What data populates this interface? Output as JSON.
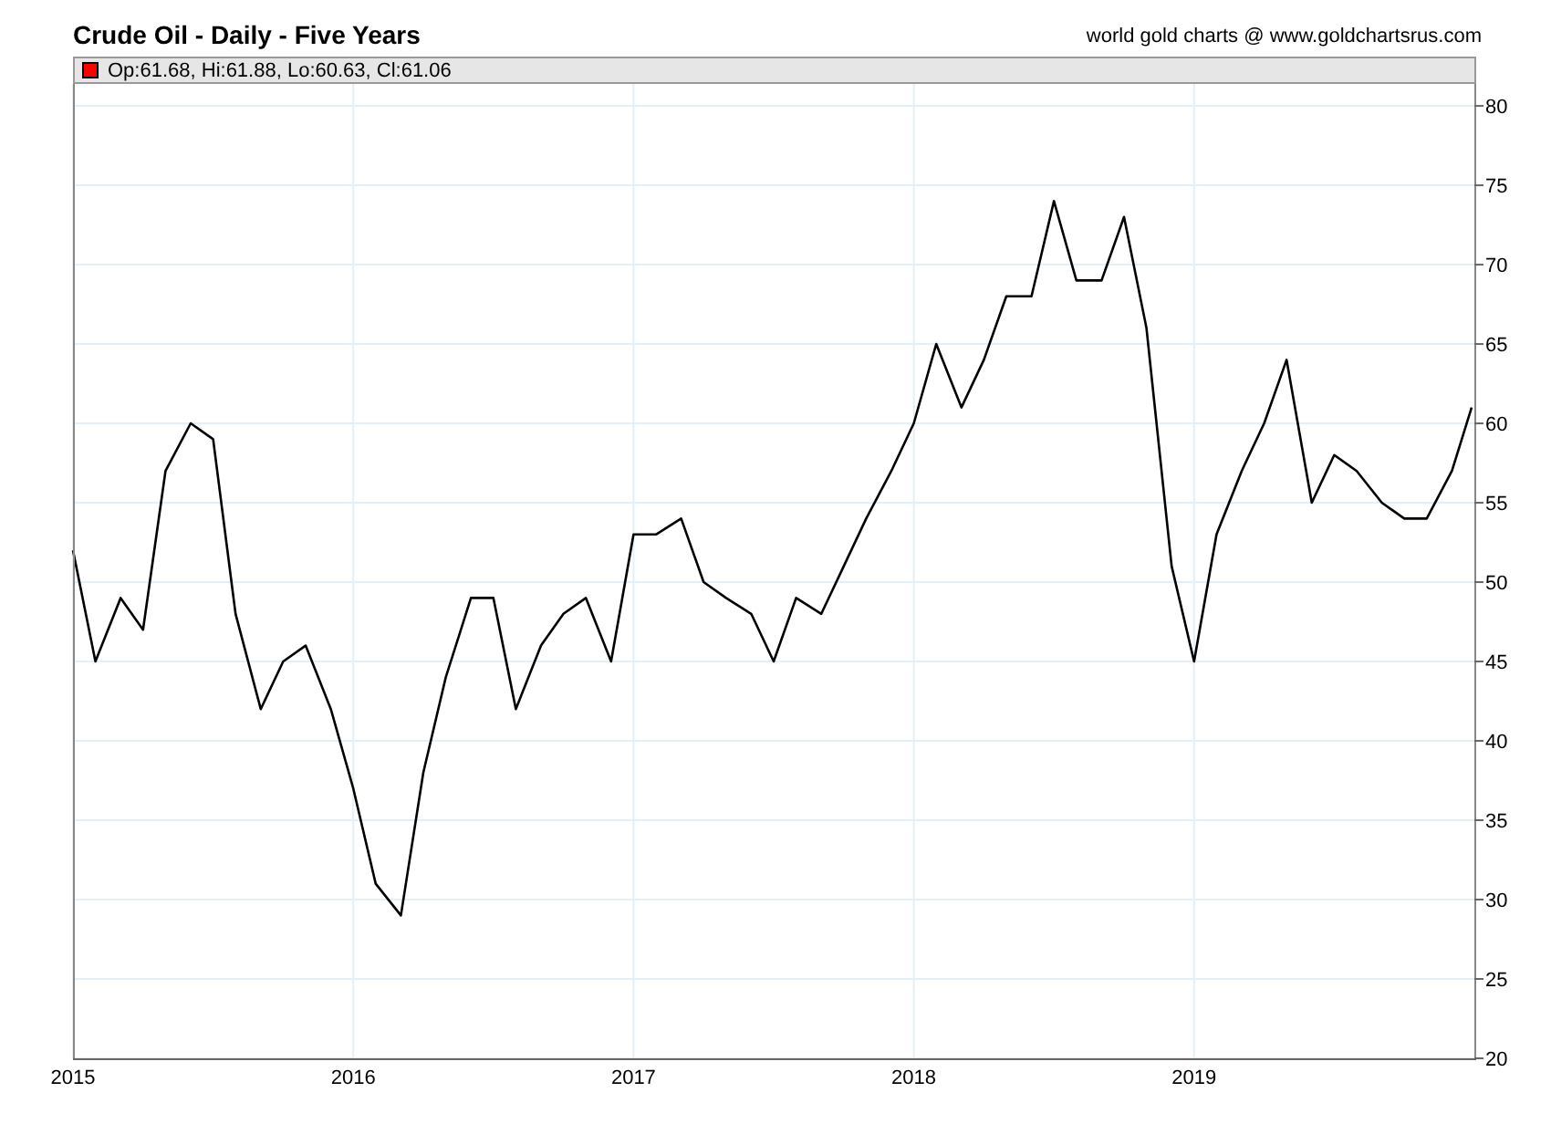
{
  "title": "Crude Oil - Daily - Five Years",
  "credit": "world gold charts @ www.goldchartsrus.com",
  "legend": "Op:61.68, Hi:61.88, Lo:60.63, Cl:61.06",
  "chart_data": {
    "type": "line",
    "x": [
      2015.0,
      2015.08,
      2015.17,
      2015.25,
      2015.33,
      2015.42,
      2015.5,
      2015.58,
      2015.67,
      2015.75,
      2015.83,
      2015.92,
      2016.0,
      2016.08,
      2016.17,
      2016.25,
      2016.33,
      2016.42,
      2016.5,
      2016.58,
      2016.67,
      2016.75,
      2016.83,
      2016.92,
      2017.0,
      2017.08,
      2017.17,
      2017.25,
      2017.33,
      2017.42,
      2017.5,
      2017.58,
      2017.67,
      2017.75,
      2017.83,
      2017.92,
      2018.0,
      2018.08,
      2018.17,
      2018.25,
      2018.33,
      2018.42,
      2018.5,
      2018.58,
      2018.67,
      2018.75,
      2018.83,
      2018.92,
      2019.0,
      2019.08,
      2019.17,
      2019.25,
      2019.33,
      2019.42,
      2019.5,
      2019.58,
      2019.67,
      2019.75,
      2019.83,
      2019.92,
      2019.99
    ],
    "series": [
      {
        "color": "#000000",
        "values": [
          52,
          45,
          49,
          47,
          57,
          60,
          59,
          48,
          42,
          45,
          46,
          42,
          37,
          31,
          29,
          38,
          44,
          49,
          49,
          42,
          46,
          48,
          49,
          45,
          53,
          53,
          54,
          50,
          49,
          48,
          45,
          49,
          48,
          51,
          54,
          57,
          60,
          65,
          61,
          64,
          68,
          68,
          74,
          69,
          69,
          73,
          66,
          51,
          45,
          53,
          57,
          60,
          64,
          55,
          58,
          57,
          55,
          54,
          54,
          57,
          61
        ]
      }
    ],
    "xlim": [
      2015,
      2020
    ],
    "ylim": [
      20,
      81.5
    ],
    "grid": true,
    "xticks": [
      {
        "value": 2015,
        "label": "2015"
      },
      {
        "value": 2016,
        "label": "2016"
      },
      {
        "value": 2017,
        "label": "2017"
      },
      {
        "value": 2018,
        "label": "2018"
      },
      {
        "value": 2019,
        "label": "2019"
      }
    ],
    "yticks": [
      20,
      25,
      30,
      35,
      40,
      45,
      50,
      55,
      60,
      65,
      70,
      75,
      80
    ]
  }
}
